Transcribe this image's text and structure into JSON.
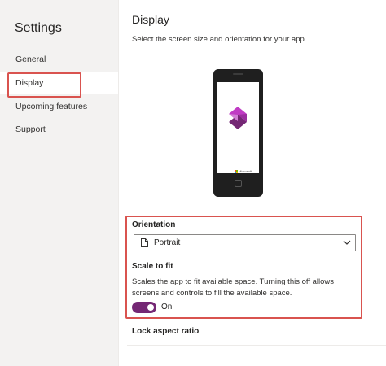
{
  "sidebar": {
    "title": "Settings",
    "items": [
      {
        "label": "General"
      },
      {
        "label": "Display",
        "selected": true
      },
      {
        "label": "Upcoming features"
      },
      {
        "label": "Support"
      }
    ]
  },
  "main": {
    "title": "Display",
    "subtitle": "Select the screen size and orientation for your app.",
    "preview": {
      "brand_text": "Microsoft",
      "logo_icon": "power-apps-logo-icon"
    },
    "orientation": {
      "label": "Orientation",
      "value": "Portrait",
      "icon": "document-icon"
    },
    "scale_to_fit": {
      "label": "Scale to fit",
      "description": "Scales the app to fit available space. Turning this off allows screens and controls to fill the available space.",
      "toggle_state": "On",
      "enabled": true
    },
    "lock_aspect_ratio": {
      "label": "Lock aspect ratio"
    }
  },
  "colors": {
    "accent": "#742774",
    "highlight": "#d9534f",
    "sidebar_bg": "#f3f2f1"
  }
}
